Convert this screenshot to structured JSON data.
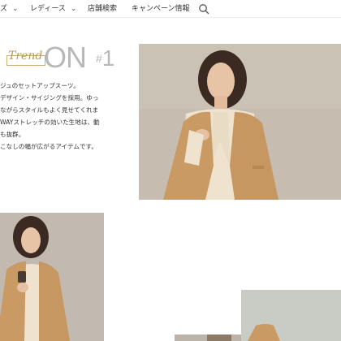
{
  "nav": {
    "items": [
      {
        "label": "ズ",
        "has_chevron": true
      },
      {
        "label": "レディース",
        "has_chevron": true
      },
      {
        "label": "店舗検索",
        "has_chevron": false
      },
      {
        "label": "キャンペーン情報",
        "has_chevron": false
      }
    ],
    "chevron_glyph": "⌄",
    "search_icon": "search-icon"
  },
  "heading": {
    "trend": "Trend",
    "on": "ON",
    "hash": "#",
    "number": "1"
  },
  "description": [
    "ジュのセットアップスーツ。",
    "デザイン・サイジングを採用。ゆっ",
    "ながらスタイルもよく見せてくれま",
    "WAYストレッチの効いた生地は、動",
    "も抜群。",
    "こなしの幅が広がるアイテムです。"
  ],
  "colors": {
    "accent_gold": "#b59a5a",
    "heading_gray": "#b8b8b8",
    "camel": "#c99a64",
    "cream": "#efe3cf"
  }
}
